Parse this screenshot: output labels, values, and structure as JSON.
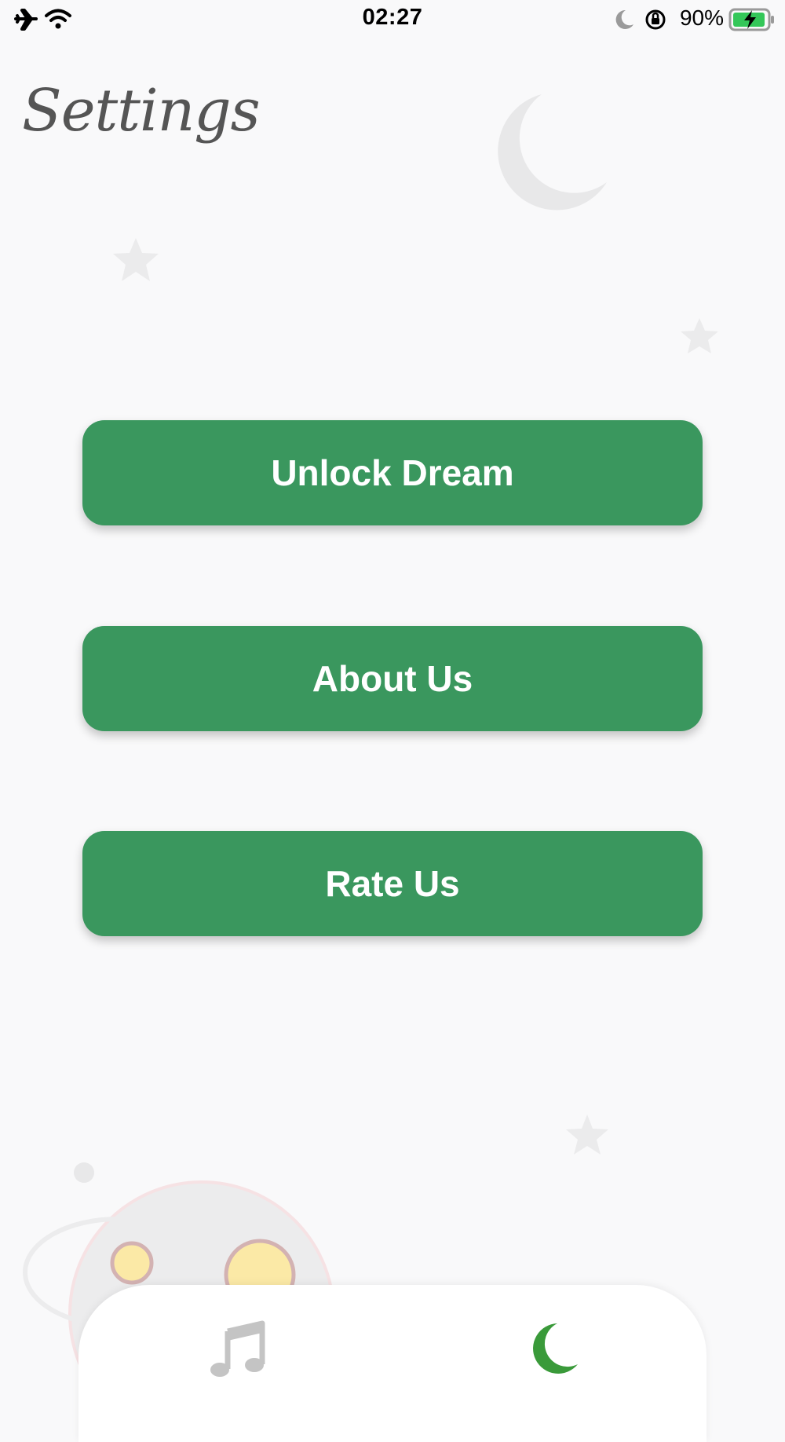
{
  "status_bar": {
    "time": "02:27",
    "battery_percent": "90%",
    "icons": [
      "airplane-icon",
      "wifi-icon",
      "moon-icon",
      "orientation-lock-icon",
      "battery-charging-icon"
    ]
  },
  "page": {
    "title": "Settings"
  },
  "buttons": {
    "unlock_label": "Unlock Dream",
    "about_label": "About Us",
    "rate_label": "Rate Us"
  },
  "tab_bar": {
    "tabs": [
      {
        "icon": "music-note-icon",
        "active": false
      },
      {
        "icon": "moon-icon",
        "active": true
      }
    ]
  },
  "colors": {
    "accent": "#3a975e",
    "active_tab": "#3a9a3a",
    "inactive_tab": "#c4c4c4",
    "background": "#f9f9fa"
  }
}
